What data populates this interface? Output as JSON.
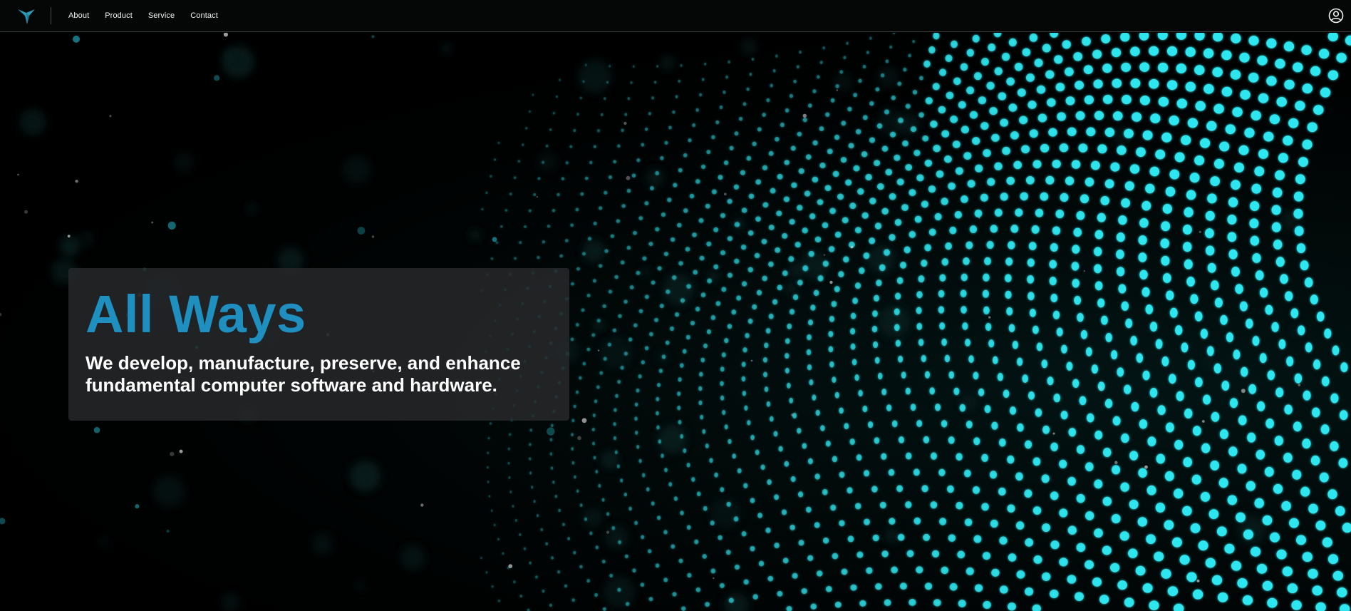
{
  "nav": {
    "logo_icon": "bird-logo-icon",
    "links": [
      {
        "label": "About"
      },
      {
        "label": "Product"
      },
      {
        "label": "Service"
      },
      {
        "label": "Contact"
      }
    ],
    "user_icon": "user-circle-icon"
  },
  "hero": {
    "title": "All Ways",
    "subtitle_line1": "We develop, manufacture, preserve, and enhance",
    "subtitle_line2": "fundamental computer software and hardware."
  },
  "colors": {
    "accent": "#1f8fc0",
    "logo": "#2a9bb8",
    "particles": "#2ee6ef",
    "nav_background": "#050606"
  }
}
